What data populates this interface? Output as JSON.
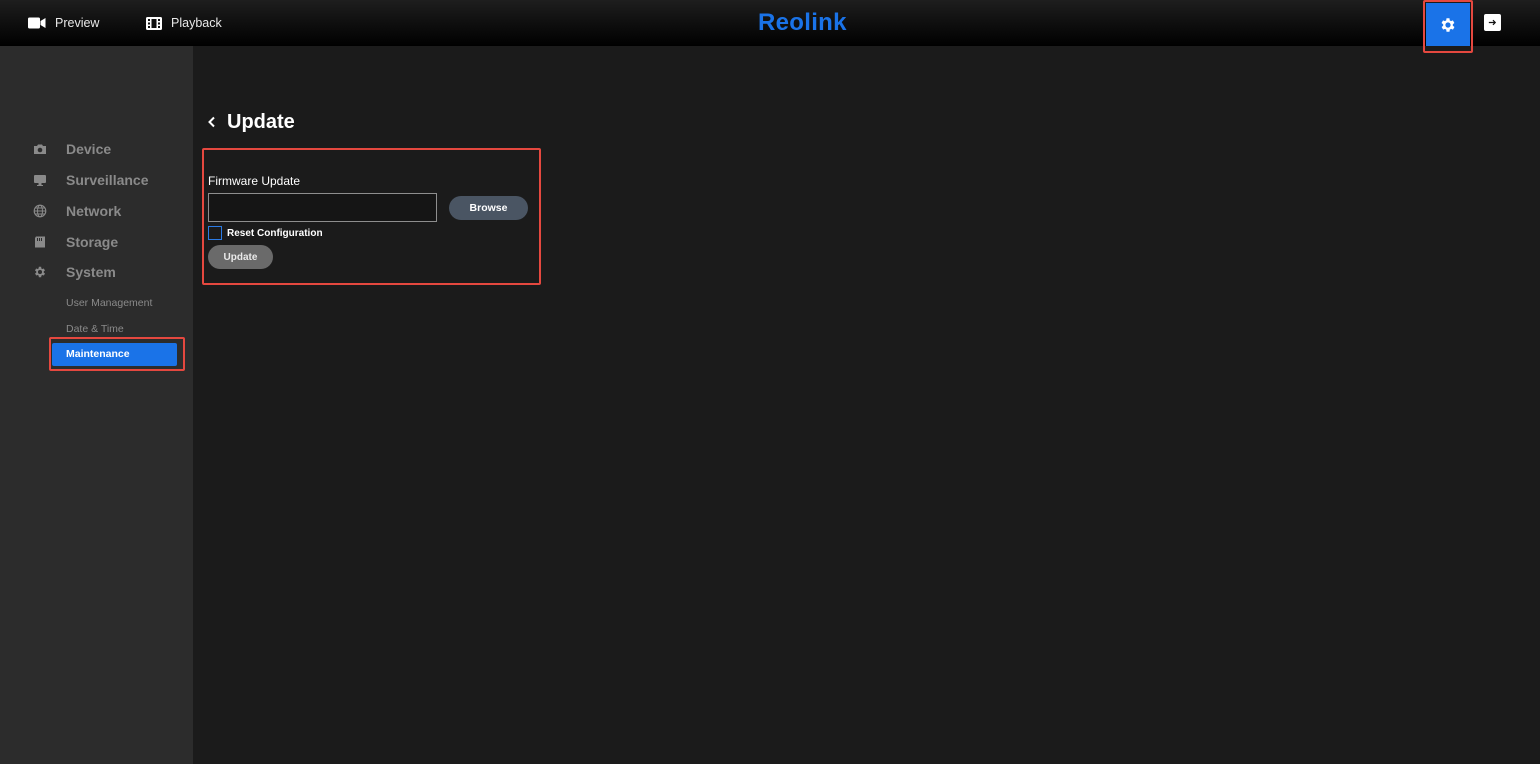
{
  "header": {
    "nav": [
      {
        "label": "Preview",
        "icon": "video-camera-icon"
      },
      {
        "label": "Playback",
        "icon": "film-icon"
      }
    ],
    "logo": "Reolink",
    "settings_icon": "gear-icon",
    "logout_icon": "logout-icon"
  },
  "sidebar": {
    "items": [
      {
        "label": "Device",
        "icon": "camera-icon"
      },
      {
        "label": "Surveillance",
        "icon": "monitor-icon"
      },
      {
        "label": "Network",
        "icon": "globe-icon"
      },
      {
        "label": "Storage",
        "icon": "storage-icon"
      },
      {
        "label": "System",
        "icon": "gear-icon"
      }
    ],
    "system_sub": [
      "User Management",
      "Date & Time",
      "Maintenance"
    ],
    "active_sub": "Maintenance"
  },
  "main": {
    "title": "Update",
    "firmware_label": "Firmware Update",
    "file_value": "",
    "browse_label": "Browse",
    "reset_label": "Reset Configuration",
    "reset_checked": false,
    "update_label": "Update"
  },
  "colors": {
    "accent": "#1a73e8",
    "highlight": "#e5483f",
    "sidebar_bg": "#2c2c2c",
    "main_bg": "#1b1b1b"
  }
}
